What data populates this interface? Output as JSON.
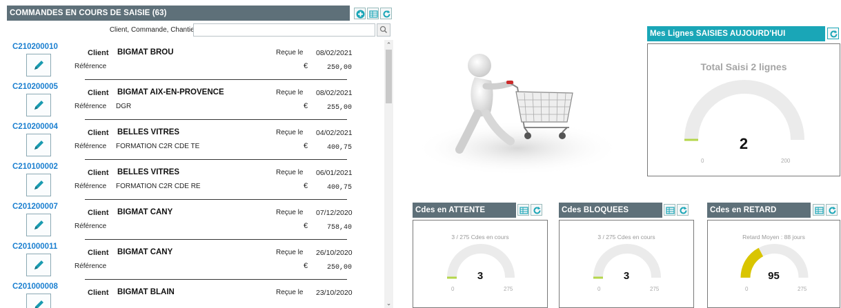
{
  "orders_panel": {
    "title": "COMMANDES EN COURS  DE SAISIE (63)",
    "search_label": "Client, Commande, Chantier",
    "search_value": "",
    "labels": {
      "client": "Client",
      "reference": "Référence",
      "received": "Reçue le",
      "currency": "€"
    },
    "orders": [
      {
        "code": "C210200010",
        "client": "BIGMAT BROU",
        "reference": "",
        "date": "08/02/2021",
        "amount": "250,00"
      },
      {
        "code": "C210200005",
        "client": "BIGMAT AIX-EN-PROVENCE",
        "reference": "DGR",
        "date": "08/02/2021",
        "amount": "255,00"
      },
      {
        "code": "C210200004",
        "client": "BELLES VITRES",
        "reference": "FORMATION C2R CDE TE",
        "date": "04/02/2021",
        "amount": "400,75"
      },
      {
        "code": "C210100002",
        "client": "BELLES VITRES",
        "reference": "FORMATION C2R CDE RE",
        "date": "06/01/2021",
        "amount": "400,75"
      },
      {
        "code": "C201200007",
        "client": "BIGMAT CANY",
        "reference": "",
        "date": "07/12/2020",
        "amount": "758,40"
      },
      {
        "code": "C201000011",
        "client": "BIGMAT CANY",
        "reference": "",
        "date": "26/10/2020",
        "amount": "250,00"
      },
      {
        "code": "C201000008",
        "client": "BIGMAT BLAIN",
        "reference": "",
        "date": "23/10/2020",
        "amount": ""
      }
    ]
  },
  "today_panel": {
    "title": "Mes Lignes SAISIES AUJOURD'HUI",
    "subtitle": "Total Saisi 2 lignes",
    "value": "2",
    "min": "0",
    "max": "200",
    "fraction": 0.01
  },
  "attente_panel": {
    "title": "Cdes en ATTENTE",
    "subtitle": "3 / 275 Cdes en cours",
    "value": "3",
    "min": "0",
    "max": "275",
    "fraction": 0.011
  },
  "bloquees_panel": {
    "title": "Cdes BLOQUEES",
    "subtitle": "3 / 275 Cdes en cours",
    "value": "3",
    "min": "0",
    "max": "275",
    "fraction": 0.011
  },
  "retard_panel": {
    "title": "Cdes en RETARD",
    "subtitle": "Retard Moyen : 88 jours",
    "value": "95",
    "min": "0",
    "max": "275",
    "fraction": 0.345
  },
  "colors": {
    "header": "#5e7079",
    "header_teal": "#1aa6b7",
    "link_blue": "#1a7fd0",
    "gauge_green": "#b4d64a",
    "gauge_yellow": "#d9c500",
    "gauge_track": "#ebebeb"
  }
}
